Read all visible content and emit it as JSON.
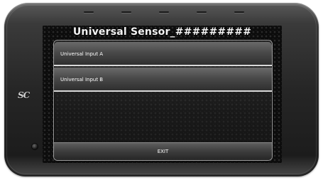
{
  "screen": {
    "title": "Universal Sensor_#########"
  },
  "menu": {
    "items": [
      {
        "label": "Universal Input A"
      },
      {
        "label": "Universal Input B"
      }
    ]
  },
  "footer": {
    "exit_label": "EXIT"
  },
  "device": {
    "logo_text": "SC",
    "logo_icon": "brand-logo-icon"
  },
  "colors": {
    "screen_background": "#0c0c0c",
    "list_separator": "#d8d8d8",
    "text": "#ffffff"
  }
}
